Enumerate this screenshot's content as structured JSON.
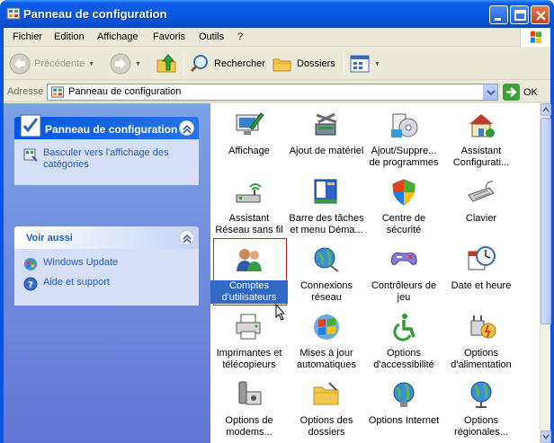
{
  "window": {
    "title": "Panneau de configuration"
  },
  "menubar": {
    "items": [
      "Fichier",
      "Edition",
      "Affichage",
      "Favoris",
      "Outils",
      "?"
    ]
  },
  "toolbar": {
    "back": "Précédente",
    "search": "Rechercher",
    "folders": "Dossiers"
  },
  "address": {
    "label": "Adresse",
    "value": "Panneau de configuration",
    "go": "OK"
  },
  "taskpane": {
    "primary": {
      "title": "Panneau de configuration",
      "link": "Basculer vers l'affichage des catégories"
    },
    "secondary": {
      "title": "Voir aussi",
      "links": [
        "Windows Update",
        "Aide et support"
      ]
    }
  },
  "items": [
    {
      "label": "Affichage",
      "icon": "display-icon"
    },
    {
      "label": "Ajout de matériel",
      "icon": "add-hardware-icon"
    },
    {
      "label": "Ajout/Suppre... de programmes",
      "icon": "add-remove-programs-icon"
    },
    {
      "label": "Assistant Configurati...",
      "icon": "network-setup-icon"
    },
    {
      "label": "Assistant Réseau sans fil",
      "icon": "wireless-network-icon"
    },
    {
      "label": "Barre des tâches et menu Démа...",
      "icon": "taskbar-icon"
    },
    {
      "label": "Centre de sécurité",
      "icon": "security-shield-icon"
    },
    {
      "label": "Clavier",
      "icon": "keyboard-icon"
    },
    {
      "label": "Comptes d'utilisateurs",
      "icon": "user-accounts-icon",
      "selected": true
    },
    {
      "label": "Connexions réseau",
      "icon": "network-connections-icon"
    },
    {
      "label": "Contrôleurs de jeu",
      "icon": "game-controller-icon"
    },
    {
      "label": "Date et heure",
      "icon": "date-time-icon"
    },
    {
      "label": "Imprimantes et télécopieurs",
      "icon": "printer-icon"
    },
    {
      "label": "Mises à jour automatiques",
      "icon": "windows-update-icon"
    },
    {
      "label": "Options d'accessibilité",
      "icon": "accessibility-icon"
    },
    {
      "label": "Options d'alimentation",
      "icon": "power-icon"
    },
    {
      "label": "Options de modems...",
      "icon": "modem-icon"
    },
    {
      "label": "Options des dossiers",
      "icon": "folder-options-icon"
    },
    {
      "label": "Options Internet",
      "icon": "internet-options-icon"
    },
    {
      "label": "Options régionales...",
      "icon": "regional-options-icon"
    }
  ]
}
